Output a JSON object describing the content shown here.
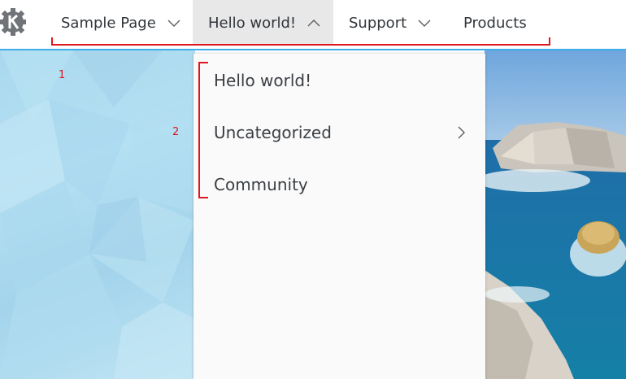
{
  "nav": {
    "items": [
      {
        "label": "Sample Page",
        "has_dropdown": true
      },
      {
        "label": "Hello world!",
        "has_dropdown": true,
        "expanded": true
      },
      {
        "label": "Support",
        "has_dropdown": true
      },
      {
        "label": "Products",
        "has_dropdown": false
      }
    ]
  },
  "dropdown": {
    "items": [
      {
        "label": "Hello world!"
      },
      {
        "label": "Uncategorized",
        "has_submenu": true
      },
      {
        "label": "Community"
      }
    ]
  },
  "annotations": [
    "1",
    "2"
  ],
  "colors": {
    "accent": "#3daee9",
    "annotation": "#e0151e",
    "text": "#31363b",
    "active_bg": "#e8e8e8"
  }
}
